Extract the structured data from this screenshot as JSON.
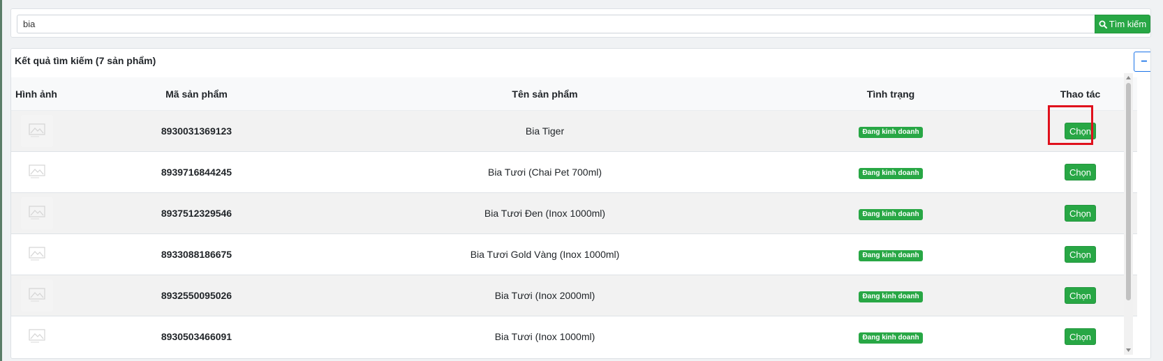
{
  "search": {
    "value": "bia",
    "button_label": "Tìm kiếm",
    "button_icon": "search-icon"
  },
  "results": {
    "title": "Kết quả tìm kiếm (7 sản phẩm)",
    "collapse_label": "−",
    "columns": [
      "Hình ảnh",
      "Mã sản phẩm",
      "Tên sản phẩm",
      "Tình trạng",
      "Thao tác"
    ],
    "rows": [
      {
        "code": "8930031369123",
        "name": "Bia Tiger",
        "status": "Đang kinh doanh",
        "action": "Chọn"
      },
      {
        "code": "8939716844245",
        "name": "Bia Tươi (Chai Pet 700ml)",
        "status": "Đang kinh doanh",
        "action": "Chọn"
      },
      {
        "code": "8937512329546",
        "name": "Bia Tươi Đen (Inox 1000ml)",
        "status": "Đang kinh doanh",
        "action": "Chọn"
      },
      {
        "code": "8933088186675",
        "name": "Bia Tươi Gold Vàng (Inox 1000ml)",
        "status": "Đang kinh doanh",
        "action": "Chọn"
      },
      {
        "code": "8932550095026",
        "name": "Bia Tươi (Inox 2000ml)",
        "status": "Đang kinh doanh",
        "action": "Chọn"
      },
      {
        "code": "8930503466091",
        "name": "Bia Tươi (Inox 1000ml)",
        "status": "Đang kinh doanh",
        "action": "Chọn"
      }
    ]
  },
  "colors": {
    "accent_green": "#28a745",
    "collapse_blue": "#1a73e8",
    "highlight_red": "#e0101c"
  }
}
